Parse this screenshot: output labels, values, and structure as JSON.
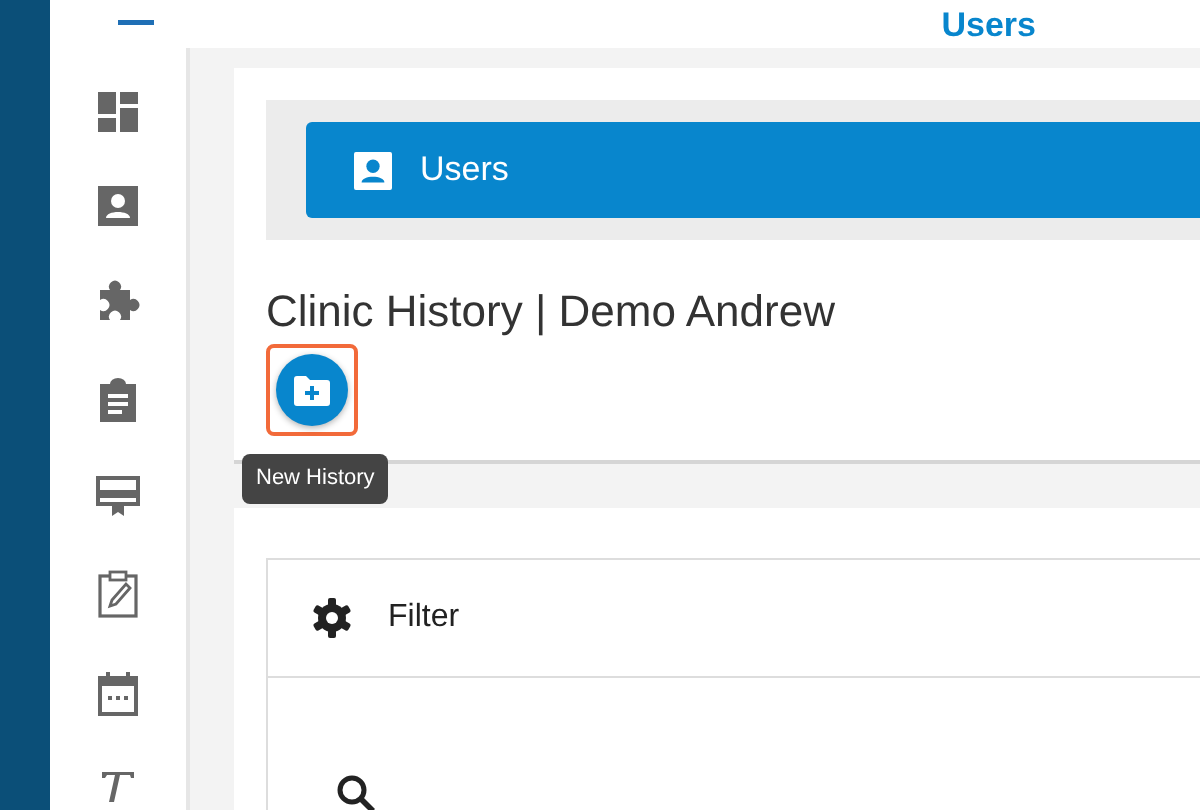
{
  "header": {
    "title": "Users"
  },
  "nav_button": {
    "label": "Users"
  },
  "page_title": "Clinic History | Demo Andrew",
  "new_button": {
    "tooltip": "New History",
    "highlighted": true
  },
  "filter_panel": {
    "title": "Filter"
  }
}
